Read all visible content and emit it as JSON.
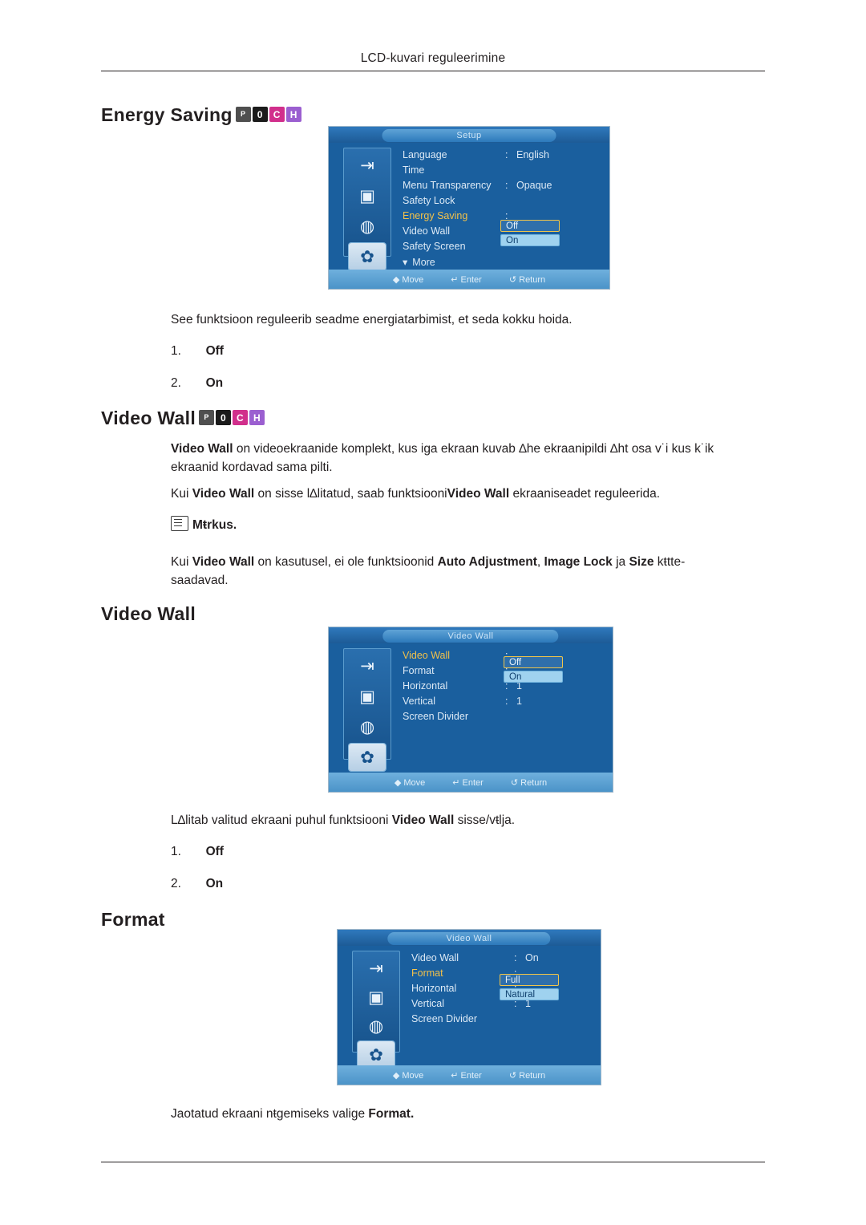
{
  "header": {
    "running_head": "LCD-kuvari reguleerimine"
  },
  "sections": {
    "energy_saving": {
      "title": "Energy Saving",
      "badges": [
        "P",
        "0",
        "C",
        "H"
      ],
      "description": "See funktsioon reguleerib seadme energiatarbimist, et seda kokku hoida.",
      "options": [
        {
          "num": "1.",
          "label": "Off"
        },
        {
          "num": "2.",
          "label": "On"
        }
      ],
      "osd": {
        "title": "Setup",
        "rows": [
          {
            "label": "Language",
            "colon": ":",
            "value": "English",
            "highlight": false
          },
          {
            "label": "Time",
            "colon": "",
            "value": "",
            "highlight": false
          },
          {
            "label": "Menu Transparency",
            "colon": ":",
            "value": "Opaque",
            "highlight": false
          },
          {
            "label": "Safety Lock",
            "colon": "",
            "value": "",
            "highlight": false
          },
          {
            "label": "Energy Saving",
            "colon": ":",
            "value": "",
            "highlight": true
          },
          {
            "label": "Video Wall",
            "colon": "",
            "value": "",
            "highlight": false
          },
          {
            "label": "Safety Screen",
            "colon": "",
            "value": "",
            "highlight": false
          }
        ],
        "more_label": "More",
        "options": [
          "Off",
          "On"
        ],
        "footer": [
          "Move",
          "Enter",
          "Return"
        ]
      }
    },
    "video_wall_intro": {
      "title": "Video Wall",
      "badges": [
        "P",
        "0",
        "C",
        "H"
      ],
      "paragraph1_bold": "Video Wall",
      "paragraph1_rest": " on videoekraanide komplekt, kus iga ekraan kuvab ∆he ekraanipildi ∆ht osa v˙i kus k˙ik ekraanid kordavad sama pilti.",
      "paragraph2_a": "Kui ",
      "paragraph2_b1": "Video Wall",
      "paragraph2_c": " on sisse l∆litatud, saab funktsiooni",
      "paragraph2_b2": "Video Wall",
      "paragraph2_d": " ekraaniseadet reguleerida.",
      "note_label": "Mŧrkus.",
      "note_a": "Kui ",
      "note_b1": "Video Wall",
      "note_c": " on kasutusel, ei ole funktsioonid ",
      "note_b2": "Auto Adjustment",
      "note_d": ", ",
      "note_b3": "Image Lock",
      "note_e": " ja ",
      "note_b4": "Size",
      "note_f": " kŧtte-",
      "note_g": "saadavad."
    },
    "video_wall": {
      "title": "Video Wall",
      "description_a": "L∆litab valitud ekraani puhul funktsiooni ",
      "description_b": "Video Wall",
      "description_c": " sisse/vŧlja.",
      "options": [
        {
          "num": "1.",
          "label": "Off"
        },
        {
          "num": "2.",
          "label": "On"
        }
      ],
      "osd": {
        "title": "Video Wall",
        "rows": [
          {
            "label": "Video Wall",
            "colon": ":",
            "value": "",
            "highlight": true
          },
          {
            "label": "Format",
            "colon": ":",
            "value": "",
            "highlight": false
          },
          {
            "label": "Horizontal",
            "colon": ":",
            "value": "1",
            "highlight": false
          },
          {
            "label": "Vertical",
            "colon": ":",
            "value": "1",
            "highlight": false
          },
          {
            "label": "Screen Divider",
            "colon": "",
            "value": "",
            "highlight": false
          }
        ],
        "options": [
          "Off",
          "On"
        ],
        "footer": [
          "Move",
          "Enter",
          "Return"
        ]
      }
    },
    "format": {
      "title": "Format",
      "caption_a": "Jaotatud ekraani nŧgemiseks valige ",
      "caption_b": "Format.",
      "osd": {
        "title": "Video Wall",
        "rows": [
          {
            "label": "Video Wall",
            "colon": ":",
            "value": "On",
            "highlight": false
          },
          {
            "label": "Format",
            "colon": ":",
            "value": "",
            "highlight": true
          },
          {
            "label": "Horizontal",
            "colon": ":",
            "value": "",
            "highlight": false
          },
          {
            "label": "Vertical",
            "colon": ":",
            "value": "1",
            "highlight": false
          },
          {
            "label": "Screen Divider",
            "colon": "",
            "value": "",
            "highlight": false
          }
        ],
        "options": [
          "Full",
          "Natural"
        ],
        "footer": [
          "Move",
          "Enter",
          "Return"
        ]
      }
    }
  },
  "icons": {
    "osd_column": [
      "input-icon",
      "picture-icon",
      "sound-icon",
      "setup-icon",
      "multicontrol-icon"
    ],
    "footer_move": "move-icon",
    "footer_enter": "enter-icon",
    "footer_return": "return-icon"
  },
  "colors": {
    "osd_background": "#1a5f9e",
    "highlight_text": "#f2c14a",
    "selected_option": "#9fd2ef"
  }
}
